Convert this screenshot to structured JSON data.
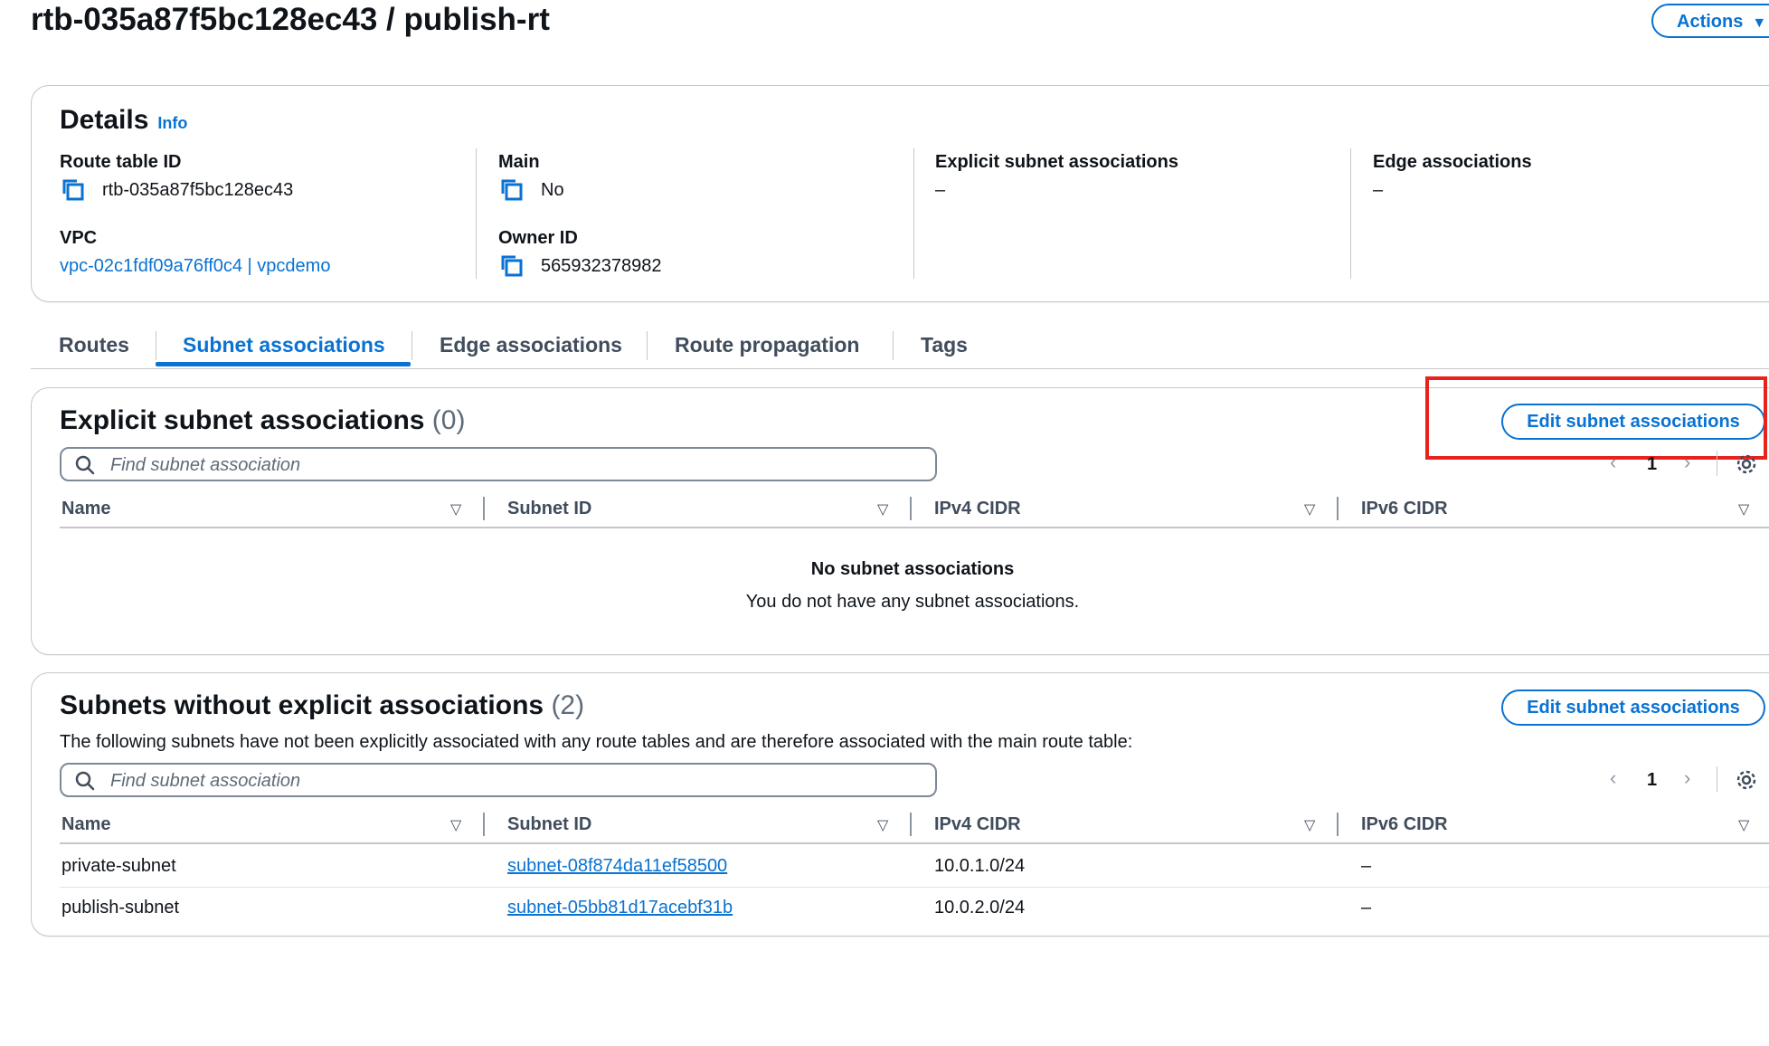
{
  "header": {
    "title": "rtb-035a87f5bc128ec43 / publish-rt",
    "actions_label": "Actions"
  },
  "details": {
    "heading": "Details",
    "info_label": "Info",
    "route_table_id_label": "Route table ID",
    "route_table_id": "rtb-035a87f5bc128ec43",
    "main_label": "Main",
    "main_value": "No",
    "explicit_label": "Explicit subnet associations",
    "explicit_value": "–",
    "edge_label": "Edge associations",
    "edge_value": "–",
    "vpc_label": "VPC",
    "vpc_value": "vpc-02c1fdf09a76ff0c4 | vpcdemo",
    "owner_label": "Owner ID",
    "owner_value": "565932378982"
  },
  "tabs": [
    {
      "label": "Routes",
      "active": false
    },
    {
      "label": "Subnet associations",
      "active": true
    },
    {
      "label": "Edge associations",
      "active": false
    },
    {
      "label": "Route propagation",
      "active": false
    },
    {
      "label": "Tags",
      "active": false
    }
  ],
  "explicit": {
    "heading": "Explicit subnet associations",
    "count": "(0)",
    "edit_label": "Edit subnet associations",
    "search_placeholder": "Find subnet association",
    "page": "1",
    "columns": [
      "Name",
      "Subnet ID",
      "IPv4 CIDR",
      "IPv6 CIDR"
    ],
    "empty_title": "No subnet associations",
    "empty_sub": "You do not have any subnet associations."
  },
  "without": {
    "heading": "Subnets without explicit associations",
    "count": "(2)",
    "description": "The following subnets have not been explicitly associated with any route tables and are therefore associated with the main route table:",
    "edit_label": "Edit subnet associations",
    "search_placeholder": "Find subnet association",
    "page": "1",
    "columns": [
      "Name",
      "Subnet ID",
      "IPv4 CIDR",
      "IPv6 CIDR"
    ],
    "rows": [
      {
        "name": "private-subnet",
        "subnet_id": "subnet-08f874da11ef58500",
        "ipv4": "10.0.1.0/24",
        "ipv6": "–"
      },
      {
        "name": "publish-subnet",
        "subnet_id": "subnet-05bb81d17acebf31b",
        "ipv4": "10.0.2.0/24",
        "ipv6": "–"
      }
    ]
  },
  "colors": {
    "accent": "#0972d3",
    "highlight": "#e8231e",
    "text": "#0f141a"
  },
  "icons": [
    "copy-icon",
    "search-icon",
    "settings-gear-icon",
    "sort-caret-icon",
    "chevron-left-icon",
    "chevron-right-icon",
    "caret-down-icon"
  ]
}
